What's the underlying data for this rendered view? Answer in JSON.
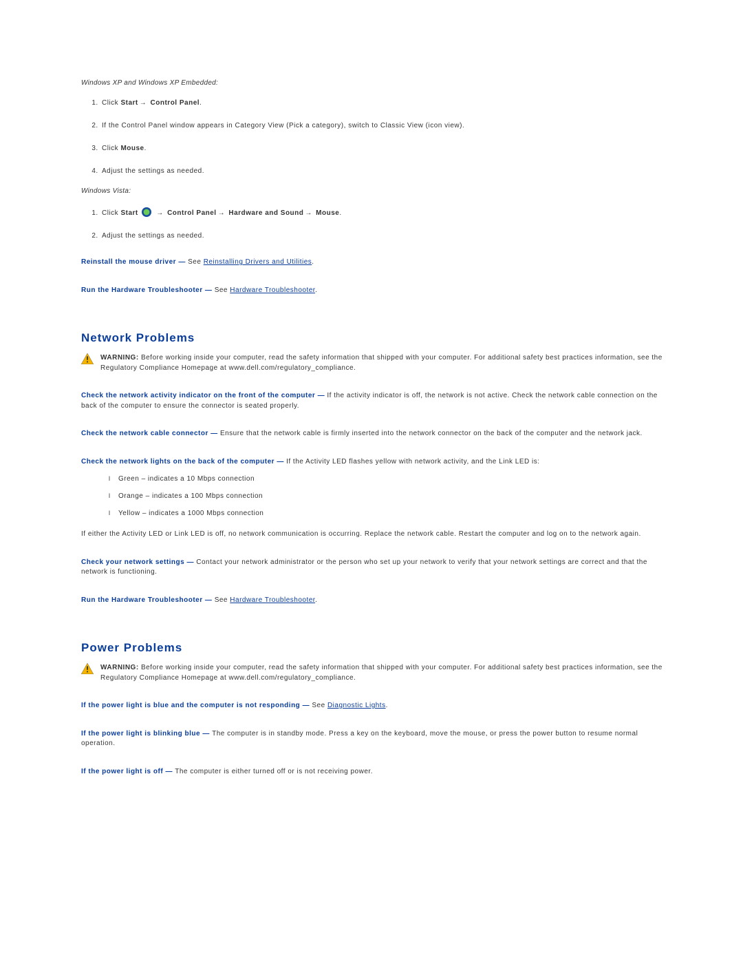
{
  "top": {
    "xp_label": "Windows XP and Windows XP Embedded:",
    "xp_steps": {
      "s1a": "Click ",
      "s1b": "Start",
      "s1c": " Control Panel",
      "s2": "If the Control Panel window appears in Category View (Pick a category), switch to Classic View (icon view).",
      "s3a": "Click ",
      "s3b": "Mouse",
      "s4": "Adjust the settings as needed."
    },
    "vista_label": "Windows Vista:",
    "vista_steps": {
      "s1a": "Click ",
      "s1b": "Start ",
      "s1c": " Control Panel",
      "s1d": " Hardware and Sound",
      "s1e": " Mouse",
      "s2": "Adjust the settings as needed."
    },
    "reinstall_a": "Reinstall the mouse driver — ",
    "reinstall_b": "See ",
    "reinstall_link": "Reinstalling Drivers and Utilities",
    "hw_a": "Run the Hardware Troubleshooter — ",
    "hw_b": "See ",
    "hw_link": "Hardware Troubleshooter"
  },
  "network": {
    "title": "Network Problems",
    "warn_bold": "WARNING: ",
    "warn_text": "Before working inside your computer, read the safety information that shipped with your computer. For additional safety best practices information, see the Regulatory Compliance Homepage at www.dell.com/regulatory_compliance.",
    "p1a": "Check the network activity indicator on the front of the computer — ",
    "p1b": "If the activity indicator is off, the network is not active. Check the network cable connection on the back of the computer to ensure the connector is seated properly.",
    "p2a": "Check the network cable connector — ",
    "p2b": "Ensure that the network cable is firmly inserted into the network connector on the back of the computer and the network jack.",
    "p3a": "Check the network lights on the back of the computer — ",
    "p3b": "If the Activity LED flashes yellow with network activity, and the Link LED is:",
    "bullets": {
      "b1": "Green – indicates a 10 Mbps connection",
      "b2": "Orange – indicates a 100 Mbps connection",
      "b3": "Yellow – indicates a 1000 Mbps connection"
    },
    "p3c": "If either the Activity LED or Link LED is off, no network communication is occurring. Replace the network cable. Restart the computer and log on to the network again.",
    "p4a": "Check your network settings — ",
    "p4b": "Contact your network administrator or the person who set up your network to verify that your network settings are correct and that the network is functioning.",
    "hw_a": "Run the Hardware Troubleshooter — ",
    "hw_b": "See ",
    "hw_link": "Hardware Troubleshooter"
  },
  "power": {
    "title": "Power Problems",
    "warn_bold": "WARNING: ",
    "warn_text": "Before working inside your computer, read the safety information that shipped with your computer. For additional safety best practices information, see the Regulatory Compliance Homepage at www.dell.com/regulatory_compliance.",
    "p1a": "If the power light is blue and the computer is not responding — ",
    "p1b": "See ",
    "p1_link": "Diagnostic Lights",
    "p2a": "If the power light is blinking blue — ",
    "p2b": "The computer is in standby mode. Press a key on the keyboard, move the mouse, or press the power button to resume normal operation.",
    "p3a": "If the power light is off — ",
    "p3b": "The computer is either turned off or is not receiving power."
  },
  "symbols": {
    "arrow": "→",
    "dot": "."
  }
}
